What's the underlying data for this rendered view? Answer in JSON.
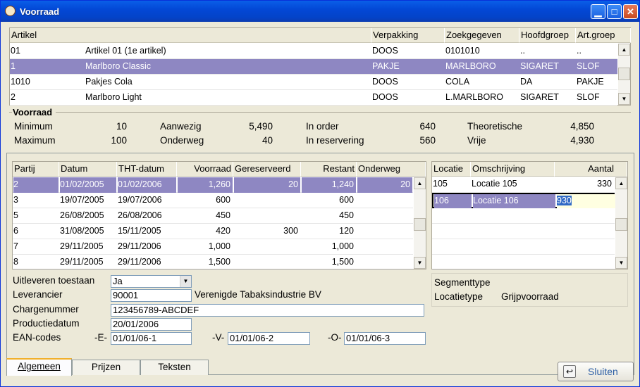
{
  "window": {
    "title": "Voorraad"
  },
  "article_table": {
    "headers": [
      "Artikel",
      "",
      "Verpakking",
      "Zoekgegeven",
      "Hoofdgroep",
      "Art.groep"
    ],
    "rows": [
      [
        "01",
        "Artikel 01 (1e artikel)",
        "DOOS",
        "0101010",
        "..",
        ".."
      ],
      [
        "1",
        "Marlboro Classic",
        "PAKJE",
        "MARLBORO",
        "SIGARET",
        "SLOF"
      ],
      [
        "1010",
        "Pakjes Cola",
        "DOOS",
        "COLA",
        "DA",
        "PAKJE"
      ],
      [
        "2",
        "Marlboro Light",
        "DOOS",
        "L.MARLBORO",
        "SIGARET",
        "SLOF"
      ]
    ],
    "selected_row": 1
  },
  "voorraad": {
    "section_title": "Voorraad",
    "minimum_label": "Minimum",
    "minimum": "10",
    "maximum_label": "Maximum",
    "maximum": "100",
    "aanwezig_label": "Aanwezig",
    "aanwezig": "5,490",
    "onderweg_label": "Onderweg",
    "onderweg": "40",
    "inorder_label": "In order",
    "inorder": "640",
    "inreservering_label": "In reservering",
    "inreservering": "560",
    "theoretische_label": "Theoretische",
    "theoretische": "4,850",
    "vrije_label": "Vrije",
    "vrije": "4,930"
  },
  "partij_table": {
    "headers": [
      "Partij",
      "Datum",
      "THT-datum",
      "Voorraad",
      "Gereserveerd",
      "Restant",
      "Onderweg"
    ],
    "rows": [
      [
        "2",
        "01/02/2005",
        "01/02/2006",
        "1,260",
        "20",
        "1,240",
        "20"
      ],
      [
        "3",
        "19/07/2005",
        "19/07/2006",
        "600",
        "",
        "600",
        ""
      ],
      [
        "5",
        "26/08/2005",
        "26/08/2006",
        "450",
        "",
        "450",
        ""
      ],
      [
        "6",
        "31/08/2005",
        "15/11/2005",
        "420",
        "300",
        "120",
        ""
      ],
      [
        "7",
        "29/11/2005",
        "29/11/2006",
        "1,000",
        "",
        "1,000",
        ""
      ],
      [
        "8",
        "29/11/2005",
        "29/11/2006",
        "1,500",
        "",
        "1,500",
        ""
      ]
    ],
    "selected_row": 0
  },
  "locatie_table": {
    "headers": [
      "Locatie",
      "Omschrijving",
      "Aantal"
    ],
    "rows": [
      [
        "105",
        "Locatie 105",
        "330"
      ],
      [
        "106",
        "Locatie 106",
        "930"
      ]
    ],
    "selected_row": 1
  },
  "details": {
    "uitleveren_label": "Uitleveren toestaan",
    "uitleveren_value": "Ja",
    "leverancier_label": "Leverancier",
    "leverancier_code": "90001",
    "leverancier_name": "Verenigde Tabaksindustrie BV",
    "charge_label": "Chargenummer",
    "charge_value": "123456789-ABCDEF",
    "productie_label": "Productiedatum",
    "productie_value": "20/01/2006",
    "ean_label": "EAN-codes",
    "ean_e_label": "-E-",
    "ean_e": "01/01/06-1",
    "ean_v_label": "-V-",
    "ean_v": "01/01/06-2",
    "ean_o_label": "-O-",
    "ean_o": "01/01/06-3"
  },
  "segment": {
    "segmenttype_label": "Segmenttype",
    "segmenttype_value": "",
    "locatietype_label": "Locatietype",
    "locatietype_value": "Grijpvoorraad"
  },
  "tabs": [
    {
      "label": "Algemeen",
      "active": true
    },
    {
      "label": "Prijzen",
      "active": false
    },
    {
      "label": "Teksten",
      "active": false
    }
  ],
  "buttons": {
    "sluiten": "Sluiten"
  },
  "colors": {
    "selection": "#8e87c2",
    "titlebar": "#0a5fe8",
    "background": "#ece9d8"
  }
}
